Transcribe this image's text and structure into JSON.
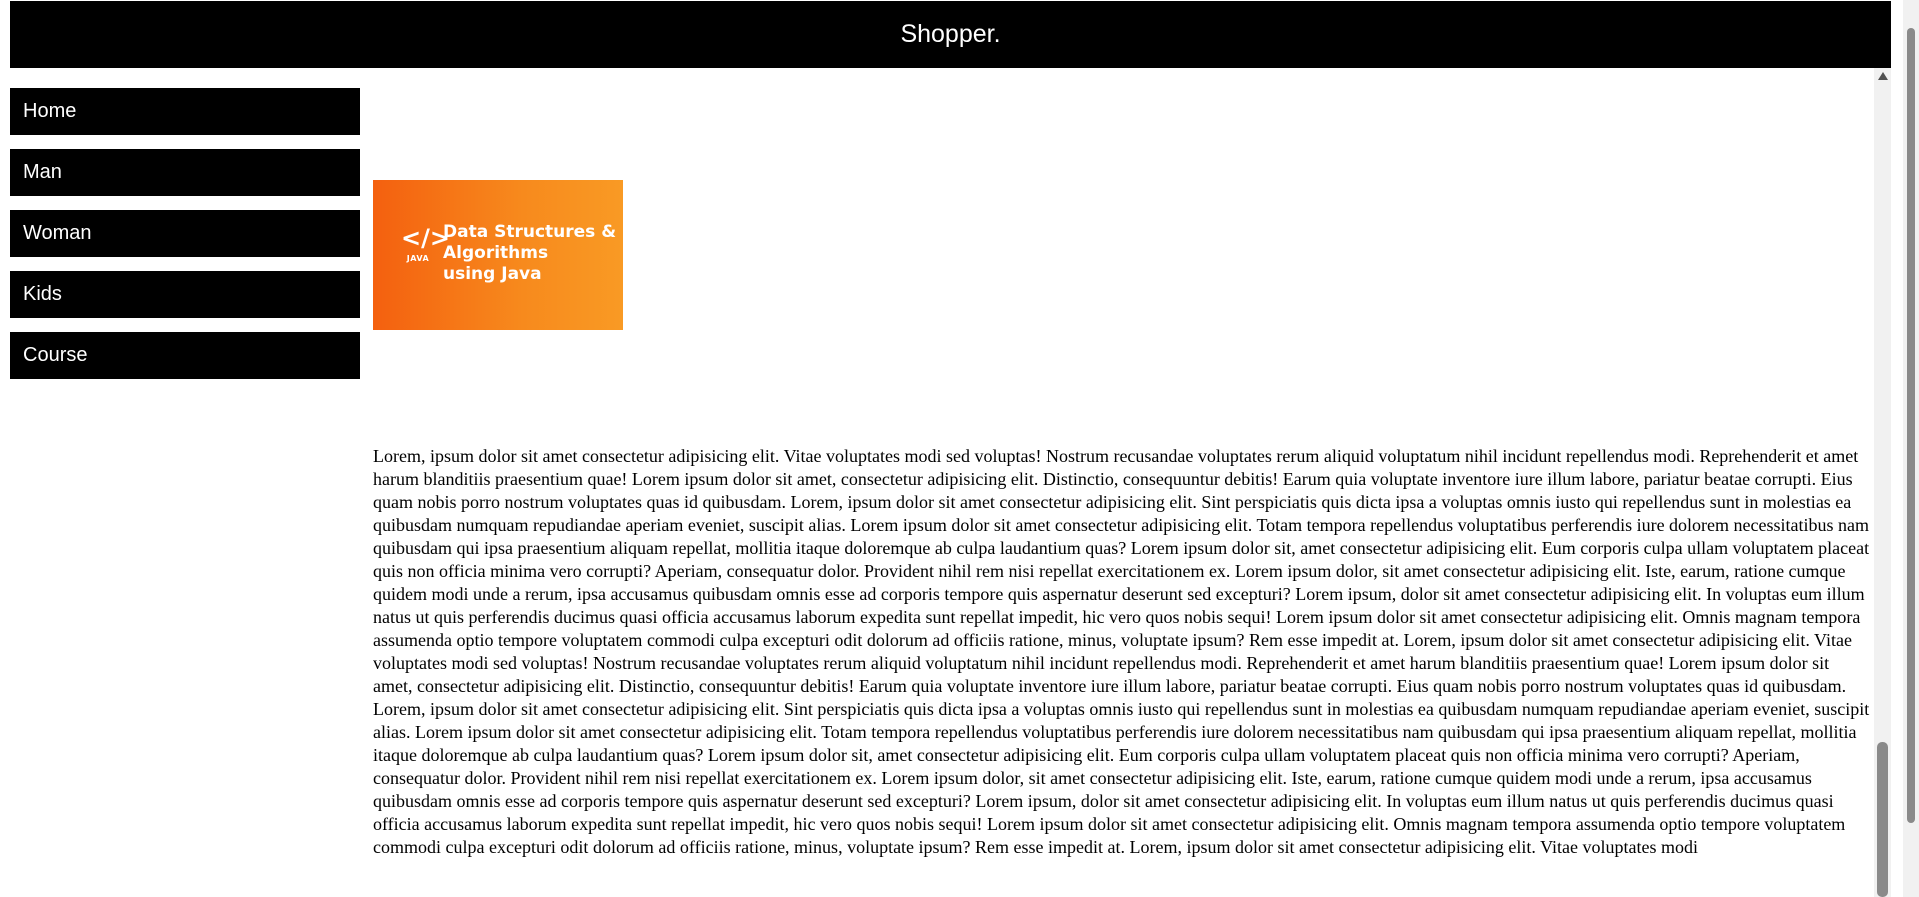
{
  "header": {
    "title": "Shopper."
  },
  "nav": {
    "items": [
      {
        "label": "Home"
      },
      {
        "label": "Man"
      },
      {
        "label": "Woman"
      },
      {
        "label": "Kids"
      },
      {
        "label": "Course"
      }
    ]
  },
  "banner": {
    "icon_glyph": "</>",
    "language": "JAVA",
    "title": "Data Structures &\nAlgorithms\nusing Java",
    "gradient_colors": [
      "#f4600f",
      "#f99a24"
    ]
  },
  "content": {
    "paragraph": "Lorem, ipsum dolor sit amet consectetur adipisicing elit. Vitae voluptates modi sed voluptas! Nostrum recusandae voluptates rerum aliquid voluptatum nihil incidunt repellendus modi. Reprehenderit et amet harum blanditiis praesentium quae! Lorem ipsum dolor sit amet, consectetur adipisicing elit. Distinctio, consequuntur debitis! Earum quia voluptate inventore iure illum labore, pariatur beatae corrupti. Eius quam nobis porro nostrum voluptates quas id quibusdam. Lorem, ipsum dolor sit amet consectetur adipisicing elit. Sint perspiciatis quis dicta ipsa a voluptas omnis iusto qui repellendus sunt in molestias ea quibusdam numquam repudiandae aperiam eveniet, suscipit alias. Lorem ipsum dolor sit amet consectetur adipisicing elit. Totam tempora repellendus voluptatibus perferendis iure dolorem necessitatibus nam quibusdam qui ipsa praesentium aliquam repellat, mollitia itaque doloremque ab culpa laudantium quas? Lorem ipsum dolor sit, amet consectetur adipisicing elit. Eum corporis culpa ullam voluptatem placeat quis non officia minima vero corrupti? Aperiam, consequatur dolor. Provident nihil rem nisi repellat exercitationem ex. Lorem ipsum dolor, sit amet consectetur adipisicing elit. Iste, earum, ratione cumque quidem modi unde a rerum, ipsa accusamus quibusdam omnis esse ad corporis tempore quis aspernatur deserunt sed excepturi? Lorem ipsum, dolor sit amet consectetur adipisicing elit. In voluptas eum illum natus ut quis perferendis ducimus quasi officia accusamus laborum expedita sunt repellat impedit, hic vero quos nobis sequi! Lorem ipsum dolor sit amet consectetur adipisicing elit. Omnis magnam tempora assumenda optio tempore voluptatem commodi culpa excepturi odit dolorum ad officiis ratione, minus, voluptate ipsum? Rem esse impedit at. Lorem, ipsum dolor sit amet consectetur adipisicing elit. Vitae voluptates modi sed voluptas! Nostrum recusandae voluptates rerum aliquid voluptatum nihil incidunt repellendus modi. Reprehenderit et amet harum blanditiis praesentium quae! Lorem ipsum dolor sit amet, consectetur adipisicing elit. Distinctio, consequuntur debitis! Earum quia voluptate inventore iure illum labore, pariatur beatae corrupti. Eius quam nobis porro nostrum voluptates quas id quibusdam. Lorem, ipsum dolor sit amet consectetur adipisicing elit. Sint perspiciatis quis dicta ipsa a voluptas omnis iusto qui repellendus sunt in molestias ea quibusdam numquam repudiandae aperiam eveniet, suscipit alias. Lorem ipsum dolor sit amet consectetur adipisicing elit. Totam tempora repellendus voluptatibus perferendis iure dolorem necessitatibus nam quibusdam qui ipsa praesentium aliquam repellat, mollitia itaque doloremque ab culpa laudantium quas? Lorem ipsum dolor sit, amet consectetur adipisicing elit. Eum corporis culpa ullam voluptatem placeat quis non officia minima vero corrupti? Aperiam, consequatur dolor. Provident nihil rem nisi repellat exercitationem ex. Lorem ipsum dolor, sit amet consectetur adipisicing elit. Iste, earum, ratione cumque quidem modi unde a rerum, ipsa accusamus quibusdam omnis esse ad corporis tempore quis aspernatur deserunt sed excepturi? Lorem ipsum, dolor sit amet consectetur adipisicing elit. In voluptas eum illum natus ut quis perferendis ducimus quasi officia accusamus laborum expedita sunt repellat impedit, hic vero quos nobis sequi! Lorem ipsum dolor sit amet consectetur adipisicing elit. Omnis magnam tempora assumenda optio tempore voluptatem commodi culpa excepturi odit dolorum ad officiis ratione, minus, voluptate ipsum? Rem esse impedit at. Lorem, ipsum dolor sit amet consectetur adipisicing elit. Vitae voluptates modi"
  },
  "colors": {
    "header_bg": "#000000",
    "nav_bg": "#000000",
    "nav_text": "#ffffff"
  }
}
